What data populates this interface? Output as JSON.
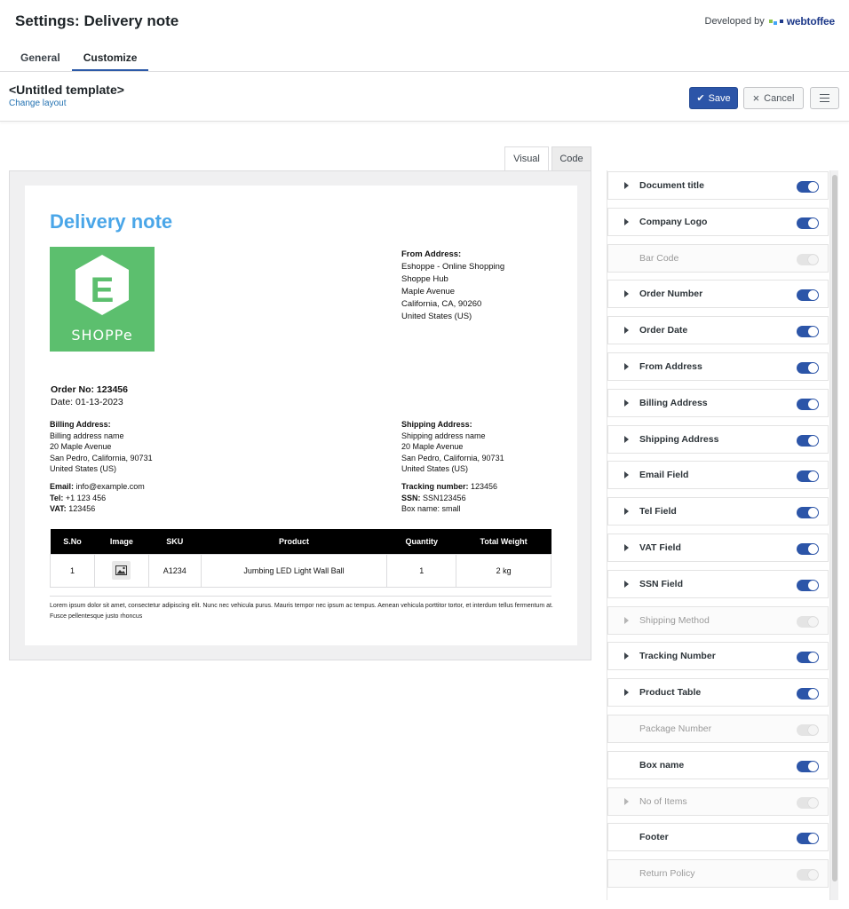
{
  "header": {
    "title": "Settings: Delivery note",
    "developed_by": "Developed by",
    "brand": "webtoffee",
    "brand_colors": [
      "#8bc34a",
      "#42a5f5",
      "#1e3a8a"
    ]
  },
  "tabs": [
    {
      "label": "General",
      "active": false
    },
    {
      "label": "Customize",
      "active": true
    }
  ],
  "toolbar": {
    "template_name": "<Untitled template>",
    "change_layout": "Change layout",
    "save_label": "Save",
    "cancel_label": "Cancel"
  },
  "view_tabs": {
    "visual": "Visual",
    "code": "Code"
  },
  "document": {
    "title": "Delivery note",
    "title_color": "#4aa6e8",
    "logo_color": "#5cbf6e",
    "logo_letter": "E",
    "logo_text": "SHOPPe",
    "from": {
      "heading": "From Address:",
      "lines": [
        "Eshoppe - Online Shopping",
        "Shoppe Hub",
        "Maple Avenue",
        "California, CA, 90260",
        "United States (US)"
      ]
    },
    "order_no": "Order No: 123456",
    "order_date": "Date: 01-13-2023",
    "billing": {
      "heading": "Billing Address:",
      "lines": [
        "Billing address name",
        "20 Maple Avenue",
        "San Pedro, California, 90731",
        "United States (US)"
      ]
    },
    "shipping": {
      "heading": "Shipping Address:",
      "lines": [
        "Shipping address name",
        "20 Maple Avenue",
        "San Pedro, California, 90731",
        "United States (US)"
      ]
    },
    "contact": {
      "email_label": "Email:",
      "email": "info@example.com",
      "tel_label": "Tel:",
      "tel": "+1 123 456",
      "vat_label": "VAT:",
      "vat": "123456"
    },
    "tracking": {
      "tracking_label": "Tracking number:",
      "tracking": "123456",
      "ssn_label": "SSN:",
      "ssn": "SSN123456",
      "box_name": "Box name: small"
    },
    "table": {
      "headers": [
        "S.No",
        "Image",
        "SKU",
        "Product",
        "Quantity",
        "Total Weight"
      ],
      "rows": [
        {
          "sno": "1",
          "image": "image-icon",
          "sku": "A1234",
          "product": "Jumbing LED Light Wall Ball",
          "quantity": "1",
          "weight": "2 kg"
        }
      ]
    },
    "footer": "Lorem ipsum dolor sit amet, consectetur adipiscing elit. Nunc nec vehicula purus. Mauris tempor nec ipsum ac tempus. Aenean vehicula porttitor tortor, et interdum tellus fermentum at. Fusce pellentesque justo rhoncus"
  },
  "panel": {
    "items": [
      {
        "label": "Document title",
        "enabled": true,
        "expandable": true
      },
      {
        "label": "Company Logo",
        "enabled": true,
        "expandable": true
      },
      {
        "label": "Bar Code",
        "enabled": false,
        "expandable": false
      },
      {
        "label": "Order Number",
        "enabled": true,
        "expandable": true
      },
      {
        "label": "Order Date",
        "enabled": true,
        "expandable": true
      },
      {
        "label": "From Address",
        "enabled": true,
        "expandable": true
      },
      {
        "label": "Billing Address",
        "enabled": true,
        "expandable": true
      },
      {
        "label": "Shipping Address",
        "enabled": true,
        "expandable": true
      },
      {
        "label": "Email Field",
        "enabled": true,
        "expandable": true
      },
      {
        "label": "Tel Field",
        "enabled": true,
        "expandable": true
      },
      {
        "label": "VAT Field",
        "enabled": true,
        "expandable": true
      },
      {
        "label": "SSN Field",
        "enabled": true,
        "expandable": true
      },
      {
        "label": "Shipping Method",
        "enabled": false,
        "expandable": true
      },
      {
        "label": "Tracking Number",
        "enabled": true,
        "expandable": true
      },
      {
        "label": "Product Table",
        "enabled": true,
        "expandable": true
      },
      {
        "label": "Package Number",
        "enabled": false,
        "expandable": false
      },
      {
        "label": "Box name",
        "enabled": true,
        "expandable": false
      },
      {
        "label": "No of Items",
        "enabled": false,
        "expandable": true
      },
      {
        "label": "Footer",
        "enabled": true,
        "expandable": false
      },
      {
        "label": "Return Policy",
        "enabled": false,
        "expandable": false
      }
    ]
  }
}
